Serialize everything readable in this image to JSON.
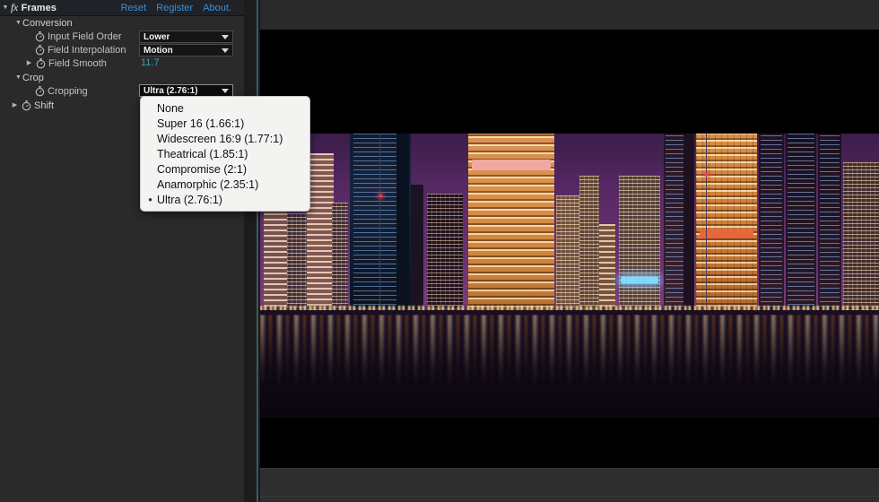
{
  "effect_panel": {
    "header": {
      "disclosure_icon": "triangle-down-icon",
      "fx_icon": "fx",
      "title": "Frames",
      "links": [
        {
          "label": "Reset",
          "name": "reset-link"
        },
        {
          "label": "Register",
          "name": "register-link"
        },
        {
          "label": "About.",
          "name": "about-link"
        }
      ],
      "link_color": "#3d8fd6"
    },
    "groups": [
      {
        "label": "Conversion",
        "expanded": true,
        "disclosure_icon": "triangle-down-icon"
      },
      {
        "label": "Crop",
        "expanded": true,
        "disclosure_icon": "triangle-down-icon"
      },
      {
        "label": "Shift",
        "expanded": false,
        "disclosure_icon": "triangle-right-icon"
      }
    ],
    "properties": [
      {
        "label": "Input Field Order",
        "type": "select",
        "value": "Lower",
        "keyframe_icon": "stopwatch-icon",
        "disclosure": "none"
      },
      {
        "label": "Field Interpolation",
        "type": "select",
        "value": "Motion",
        "keyframe_icon": "stopwatch-icon",
        "disclosure": "none"
      },
      {
        "label": "Field Smooth",
        "type": "number",
        "value": "11.7",
        "value_color": "#3fa0b5",
        "keyframe_icon": "stopwatch-icon",
        "disclosure": "triangle-right-icon"
      },
      {
        "label": "Cropping",
        "type": "select",
        "value": "Ultra (2.76:1)",
        "keyframe_icon": "stopwatch-icon",
        "disclosure": "none",
        "active": true
      }
    ]
  },
  "dropdown": {
    "open": true,
    "owner": "Cropping",
    "selected": "Ultra (2.76:1)",
    "selected_marker": "bullet-icon",
    "items": [
      {
        "label": "None",
        "selected": false
      },
      {
        "label": "Super 16 (1.66:1)",
        "selected": false
      },
      {
        "label": "Widescreen 16:9 (1.77:1)",
        "selected": false
      },
      {
        "label": "Theatrical (1.85:1)",
        "selected": false
      },
      {
        "label": "Compromise (2:1)",
        "selected": false
      },
      {
        "label": "Anamorphic (2.35:1)",
        "selected": false
      },
      {
        "label": "Ultra (2.76:1)",
        "selected": true
      }
    ]
  },
  "viewer": {
    "name": "composition-viewer",
    "background": "#000000",
    "image": {
      "description": "night cityscape with illuminated skyscrapers reflected in water",
      "letterbox": true,
      "aspect_crop": "Ultra (2.76:1)"
    }
  }
}
